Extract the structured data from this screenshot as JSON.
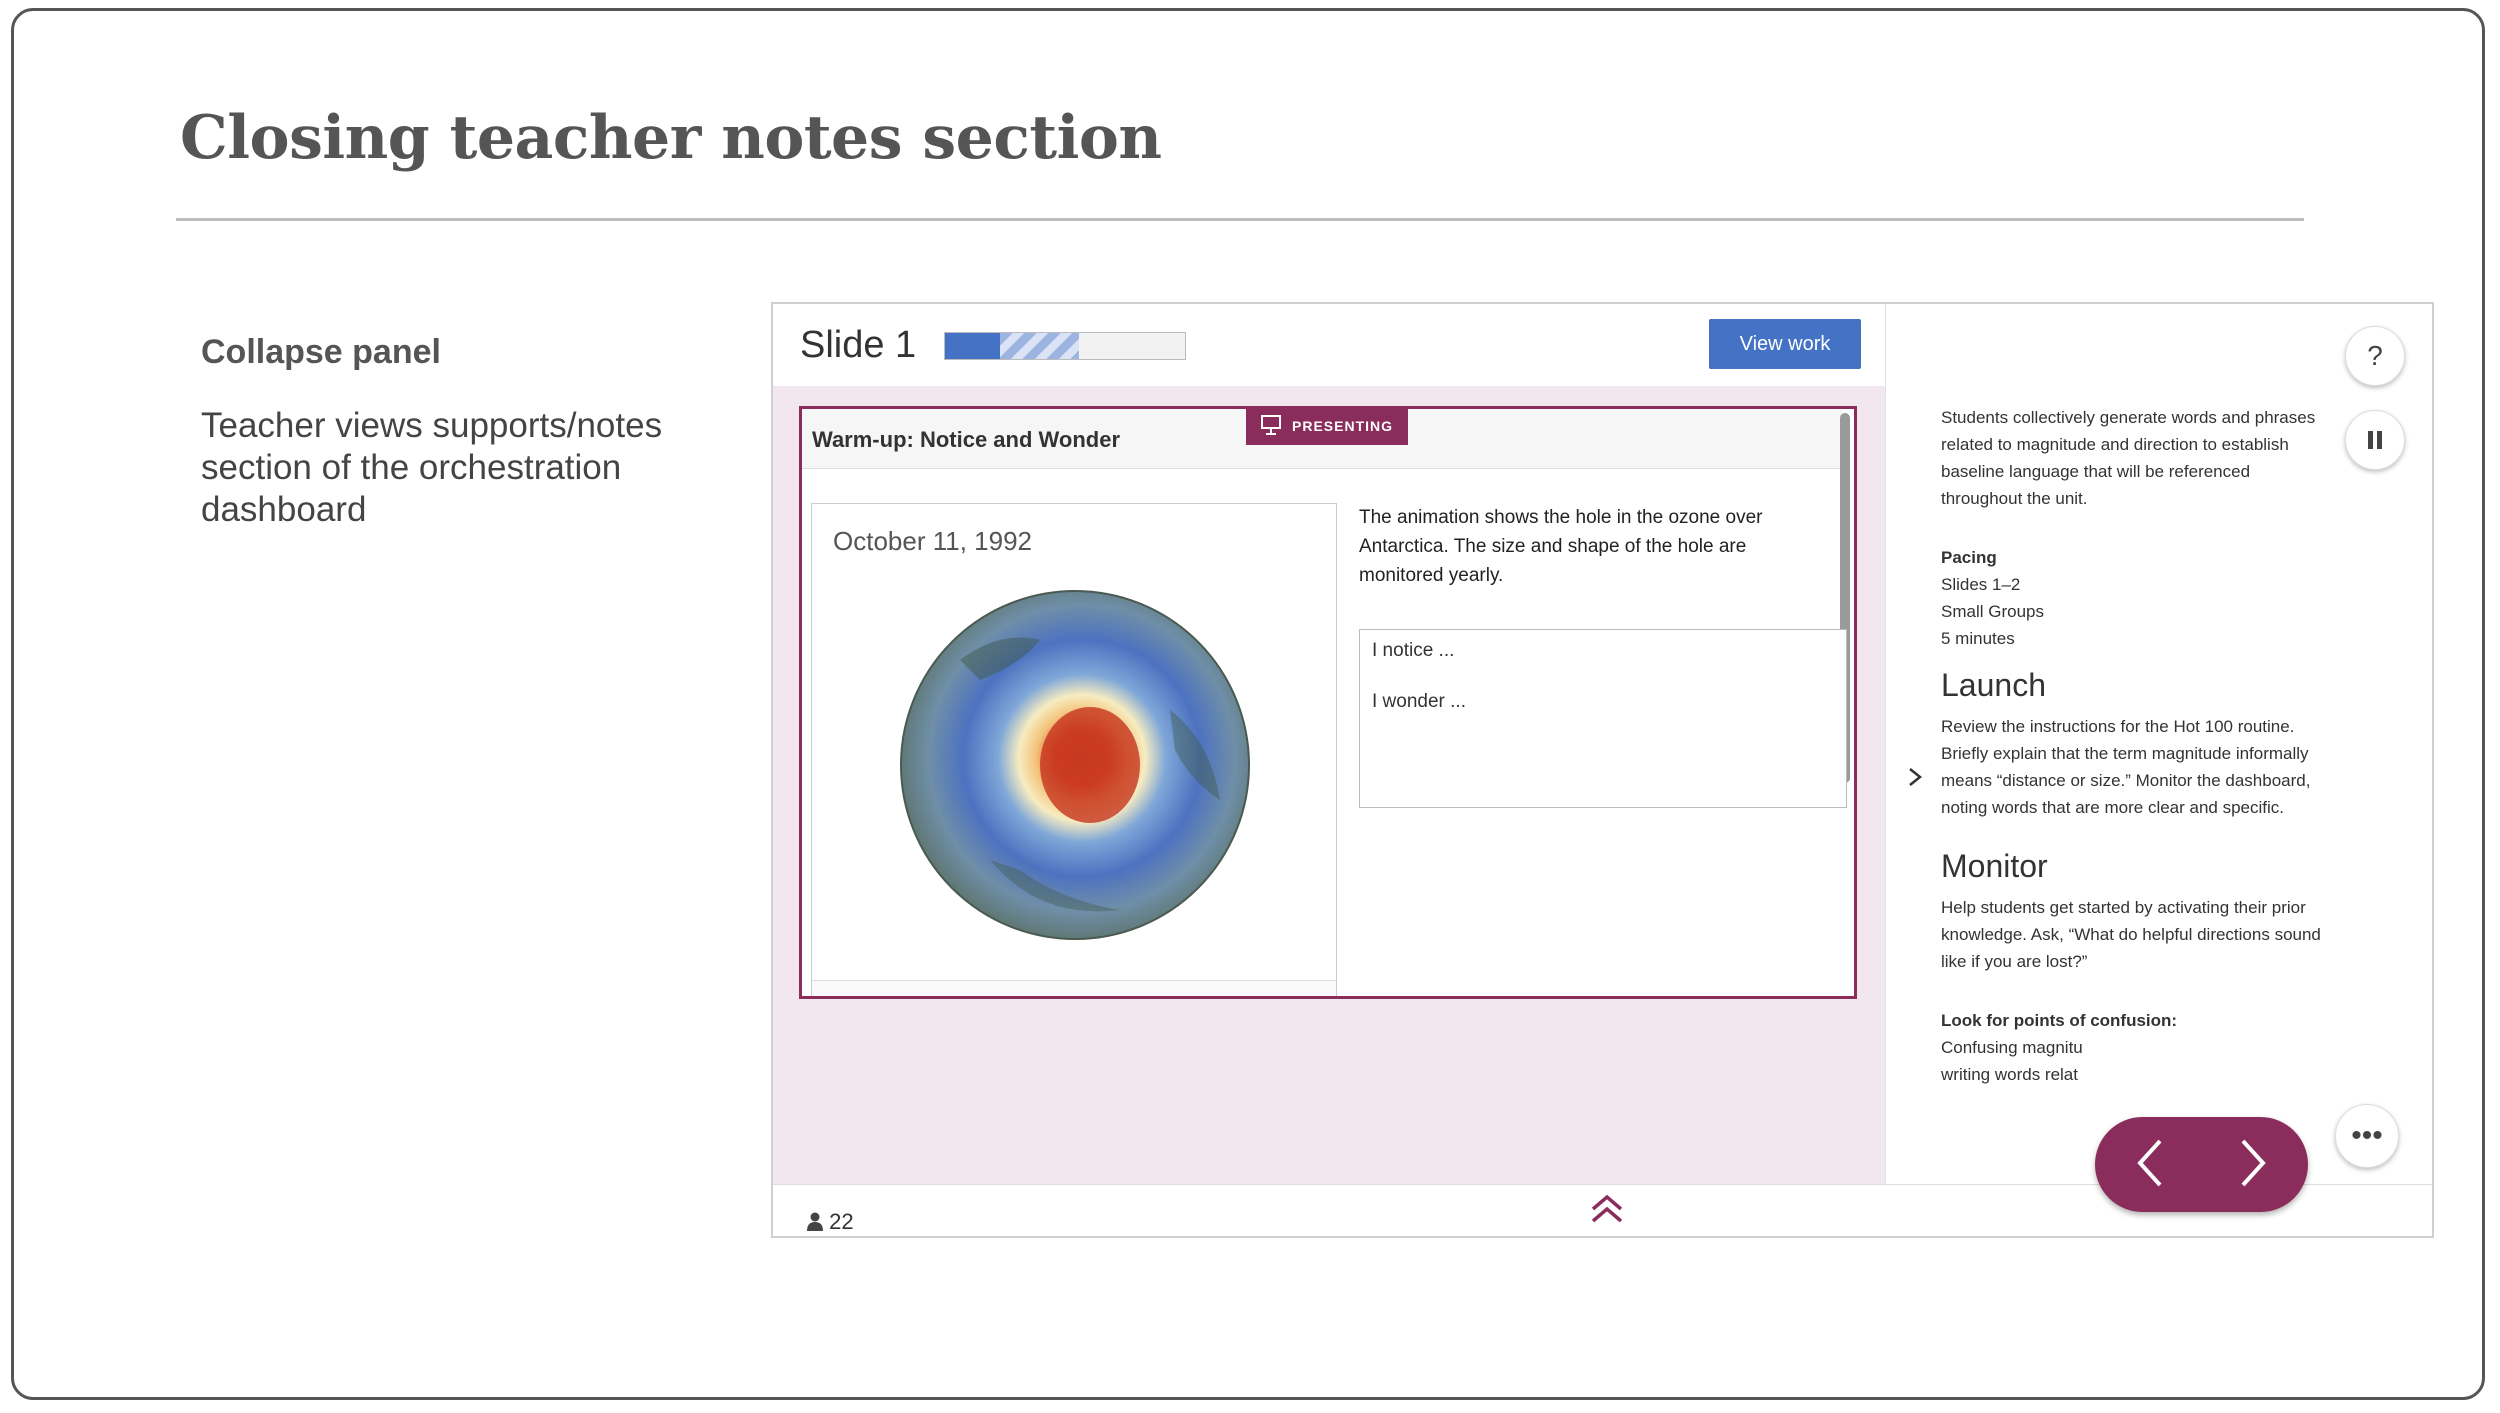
{
  "slide": {
    "title": "Closing teacher notes section",
    "left_heading": "Collapse panel",
    "left_description": "Teacher views supports/notes section of the orchestration dashboard"
  },
  "dashboard": {
    "slide_label": "Slide 1",
    "progress": {
      "complete_fraction": 0.23,
      "in_progress_fraction": 0.33
    },
    "view_work_label": "View work",
    "presenting_label": "PRESENTING",
    "card_title": "Warm-up: Notice and Wonder",
    "map_date": "October 11, 1992",
    "prompt_text": "The animation shows the hole in the ozone over Antarctica. The size and shape of the hole are monitored yearly.",
    "answer_lines": [
      "I notice ...",
      "I wonder ..."
    ],
    "student_count": "22",
    "icons": {
      "apps": "grid-icon",
      "students": "person-icon",
      "collapse": "chevron-double-up-icon",
      "expand": "chevron-right-icon"
    }
  },
  "notes": {
    "intro": "Students collectively generate words and phrases related to magnitude and direction to establish baseline language that will be referenced throughout the unit.",
    "pacing_label": "Pacing",
    "pacing_lines": [
      "Slides 1–2",
      "Small Groups",
      "5 minutes"
    ],
    "launch_heading": "Launch",
    "launch_text": "Review the instructions for the Hot 100 routine. Briefly explain that the term magnitude informally means “distance or size.” Monitor the dashboard, noting words that are more clear and specific.",
    "monitor_heading": "Monitor",
    "monitor_text": "Help students get started by activating their prior knowledge. Ask, “What do helpful directions sound like if you are lost?”",
    "look_for_label": "Look for points of confusion:",
    "look_for_line1": "Confusing magnitu",
    "look_for_line2": "writing words relat"
  },
  "controls": {
    "help_label": "?",
    "more_label": "•••",
    "icons": {
      "help": "question-icon",
      "pause": "pause-icon",
      "prev": "chevron-left-icon",
      "next": "chevron-right-icon",
      "more": "more-horizontal-icon"
    },
    "accent_color": "#8b2d5c",
    "primary_color": "#4472c4"
  }
}
